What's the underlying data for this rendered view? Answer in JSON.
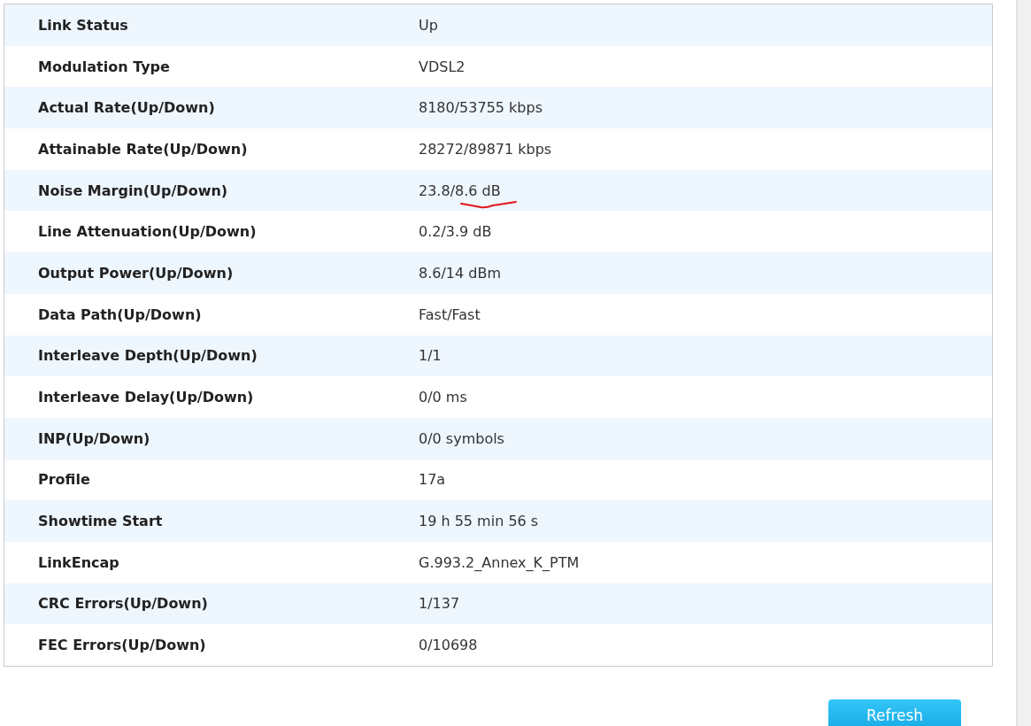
{
  "rows": [
    {
      "label": "Link Status",
      "value": "Up",
      "underlined": false
    },
    {
      "label": "Modulation Type",
      "value": "VDSL2",
      "underlined": false
    },
    {
      "label": "Actual Rate(Up/Down)",
      "value": "8180/53755 kbps",
      "underlined": false
    },
    {
      "label": "Attainable Rate(Up/Down)",
      "value": "28272/89871 kbps",
      "underlined": false
    },
    {
      "label": "Noise Margin(Up/Down)",
      "value": "23.8/8.6 dB",
      "underlined": true
    },
    {
      "label": "Line Attenuation(Up/Down)",
      "value": "0.2/3.9 dB",
      "underlined": false
    },
    {
      "label": "Output Power(Up/Down)",
      "value": "8.6/14 dBm",
      "underlined": false
    },
    {
      "label": "Data Path(Up/Down)",
      "value": "Fast/Fast",
      "underlined": false
    },
    {
      "label": "Interleave Depth(Up/Down)",
      "value": "1/1",
      "underlined": false
    },
    {
      "label": "Interleave Delay(Up/Down)",
      "value": "0/0 ms",
      "underlined": false
    },
    {
      "label": "INP(Up/Down)",
      "value": "0/0 symbols",
      "underlined": false
    },
    {
      "label": "Profile",
      "value": "17a",
      "underlined": false
    },
    {
      "label": "Showtime Start",
      "value": "19 h 55 min 56 s",
      "underlined": false
    },
    {
      "label": "LinkEncap",
      "value": "G.993.2_Annex_K_PTM",
      "underlined": false
    },
    {
      "label": "CRC Errors(Up/Down)",
      "value": "1/137",
      "underlined": false
    },
    {
      "label": "FEC Errors(Up/Down)",
      "value": "0/10698",
      "underlined": false
    }
  ],
  "refresh_button": "Refresh"
}
